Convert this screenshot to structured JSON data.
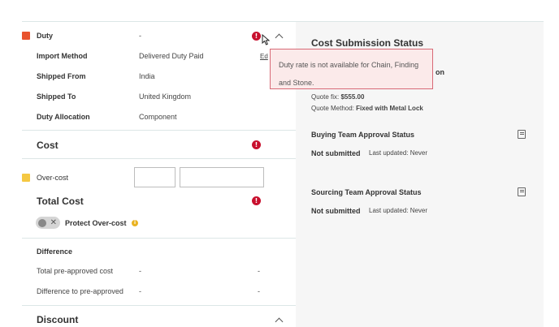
{
  "duty": {
    "title": "Duty",
    "value": "-",
    "swatch_color": "#e8532e",
    "rows": [
      {
        "label": "Import Method",
        "value": "Delivered Duty Paid"
      },
      {
        "label": "Shipped From",
        "value": "India"
      },
      {
        "label": "Shipped To",
        "value": "United Kingdom"
      },
      {
        "label": "Duty Allocation",
        "value": "Component"
      }
    ],
    "edit_link": "Ed"
  },
  "tooltip": {
    "text": "Duty rate is not available for Chain, Finding and Stone."
  },
  "cost": {
    "title": "Cost"
  },
  "overcost": {
    "label": "Over-cost",
    "swatch_color": "#f5c842"
  },
  "total_cost": {
    "title": "Total Cost",
    "protect_label": "Protect Over-cost"
  },
  "difference": {
    "title": "Difference",
    "rows": [
      {
        "label": "Total pre-approved cost",
        "value": "-",
        "value2": "-"
      },
      {
        "label": "Difference to pre-approved",
        "value": "-",
        "value2": "-"
      }
    ]
  },
  "discount": {
    "title": "Discount"
  },
  "status": {
    "title": "Cost Submission Status",
    "partial_text": "on",
    "quote_fix_label": "Quote fix:",
    "quote_fix_value": "$555.00",
    "quote_method_label": "Quote Method:",
    "quote_method_value": "Fixed with Metal Lock",
    "buying": {
      "title": "Buying Team Approval Status",
      "state": "Not submitted",
      "updated": "Last updated: Never"
    },
    "sourcing": {
      "title": "Sourcing Team Approval Status",
      "state": "Not submitted",
      "updated": "Last updated: Never"
    }
  },
  "colors": {
    "error": "#c8102e",
    "divider": "#dce6e6",
    "tooltip_border": "#d86a76",
    "tooltip_bg": "#fbeaea"
  }
}
